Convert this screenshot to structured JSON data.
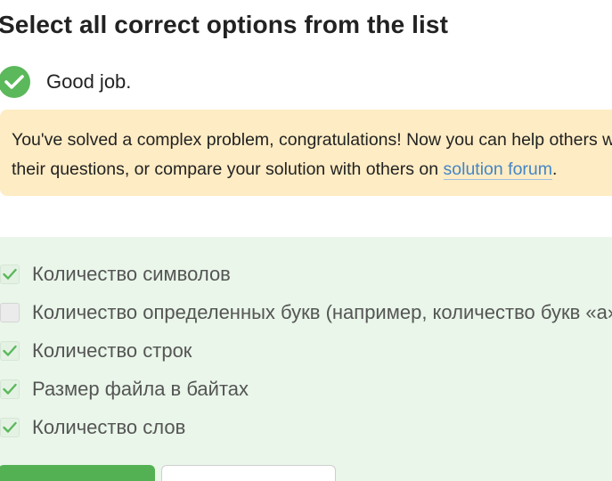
{
  "task": {
    "title": "Select all correct options from the list"
  },
  "result": {
    "icon": "check-circle-icon",
    "text": "Good job."
  },
  "notice": {
    "line1": "You've solved a complex problem, congratulations! Now you can help others with",
    "line2_prefix": "their questions, or compare your solution with others on ",
    "link_text": "solution forum",
    "line2_suffix": "."
  },
  "options": [
    {
      "label": "Количество символов",
      "checked": true
    },
    {
      "label": "Количество определенных букв (например, количество букв «а»)",
      "checked": false
    },
    {
      "label": "Количество строк",
      "checked": true
    },
    {
      "label": "Размер файла в байтах",
      "checked": true
    },
    {
      "label": "Количество слов",
      "checked": true
    }
  ],
  "colors": {
    "success": "#5bb85b",
    "notice_bg": "#feecc4",
    "options_bg": "#e9f6e9",
    "link": "#4485c5"
  }
}
